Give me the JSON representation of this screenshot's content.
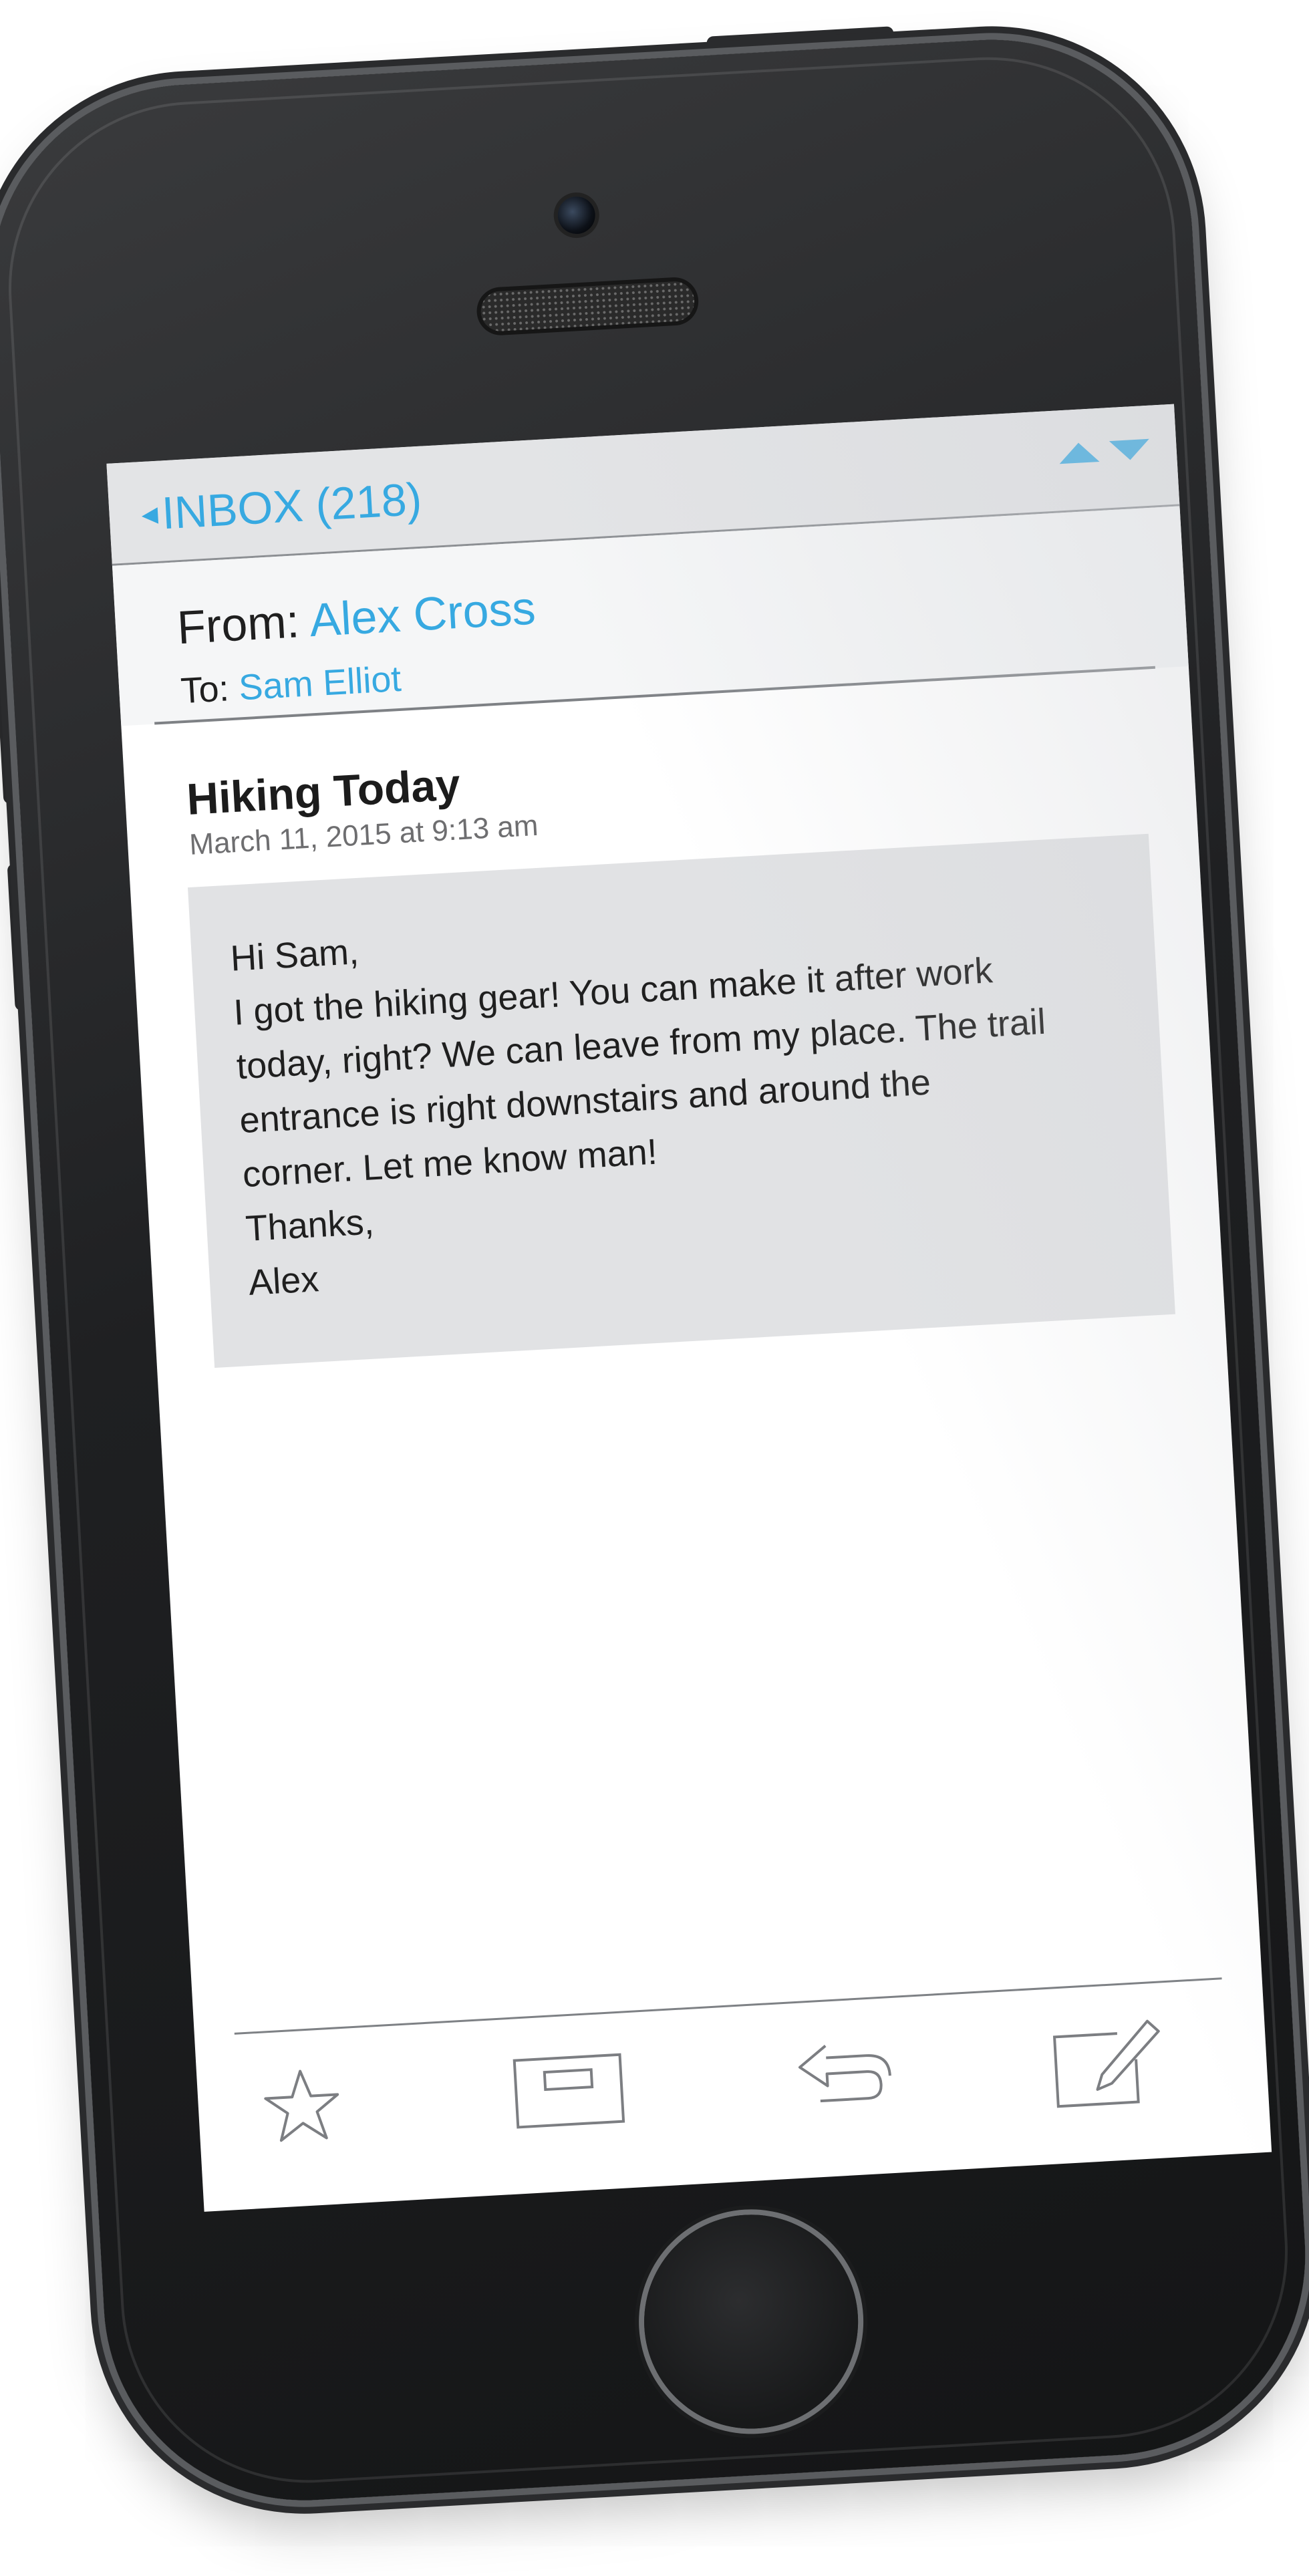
{
  "navbar": {
    "back_label": "INBOX (218)",
    "prev_icon": "triangle-up-icon",
    "next_icon": "triangle-down-icon"
  },
  "header": {
    "from_label": "From:",
    "from_name": "Alex Cross",
    "to_label": "To:",
    "to_name": "Sam Elliot"
  },
  "message": {
    "subject": "Hiking Today",
    "date": "March 11, 2015 at 9:13 am",
    "body_lines": [
      "Hi Sam,",
      "I got the hiking gear! You can make it after work",
      "today, right? We can leave from my place. The trail",
      "entrance is right downstairs and around the",
      "corner. Let me know man!",
      "Thanks,",
      "Alex"
    ]
  },
  "toolbar": {
    "items": [
      "star-icon",
      "archive-icon",
      "reply-icon",
      "compose-icon"
    ]
  },
  "colors": {
    "accent": "#37a9e1",
    "navbar_bg": "#e3e4e6",
    "body_bg": "#e1e2e4",
    "phone_body": "#1f2022"
  }
}
